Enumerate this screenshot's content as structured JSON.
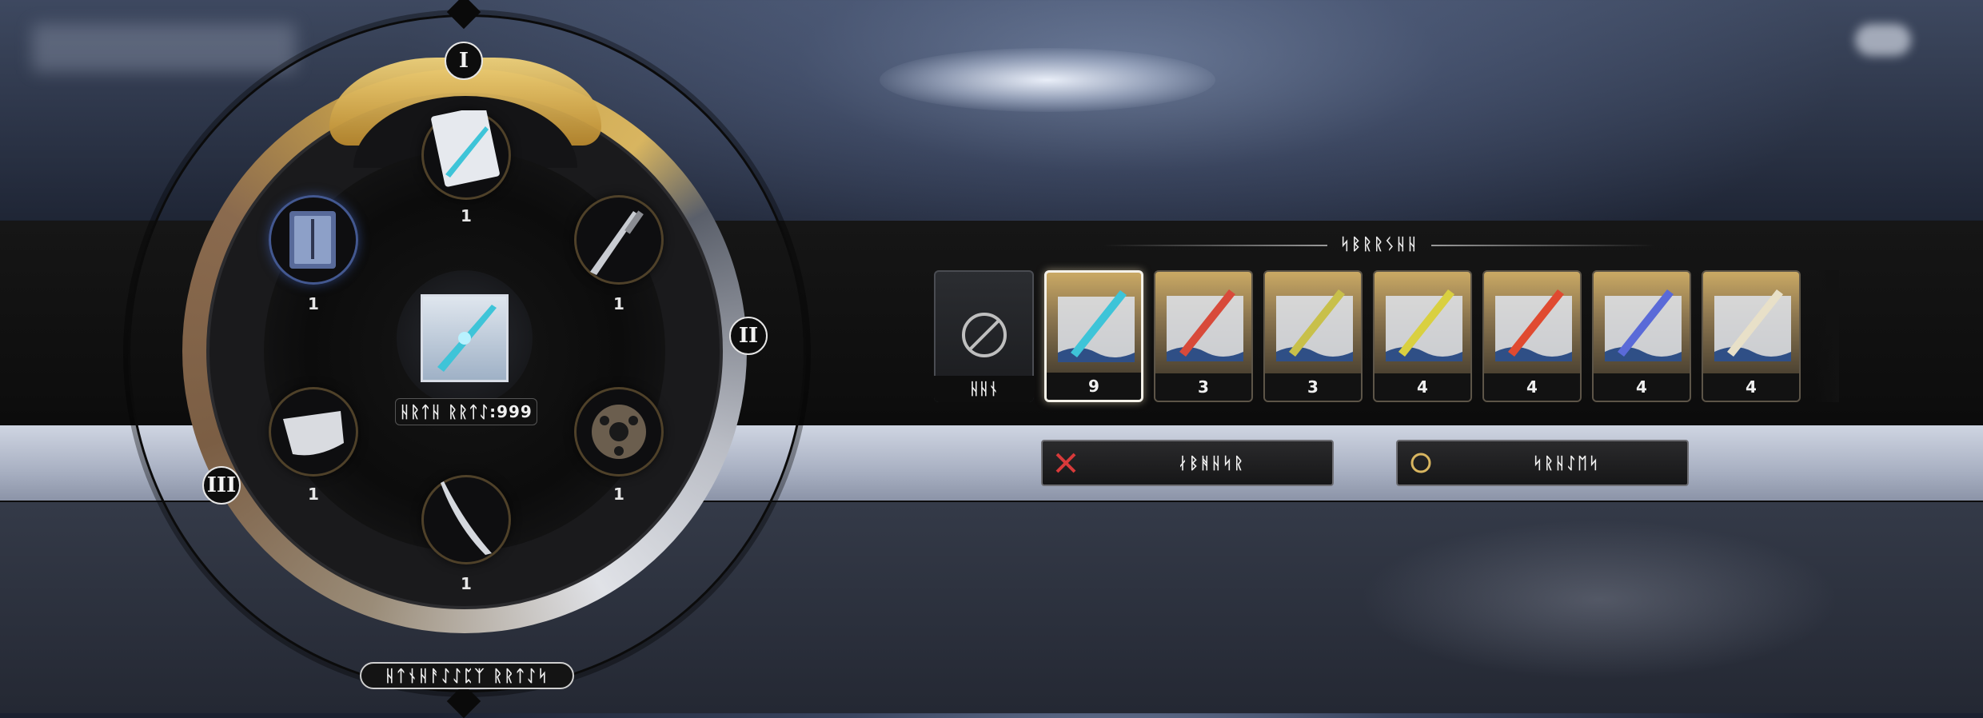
{
  "wheel": {
    "roman_top": "I",
    "roman_right": "II",
    "roman_left": "III",
    "center_label": "ᚺᚱᛏᚺ ᚱᚱᛏᛇ:999",
    "bottom_label": "ᚺᛏᚾᚺᚨᛇᛇᛈᛉ ᚱᚱᛏᛇᛋ",
    "slots": [
      {
        "name": "card",
        "count": "1"
      },
      {
        "name": "sword",
        "count": "1"
      },
      {
        "name": "orb",
        "count": "1"
      },
      {
        "name": "blade",
        "count": "1"
      },
      {
        "name": "cape",
        "count": "1"
      },
      {
        "name": "tome",
        "count": "1"
      }
    ]
  },
  "panel": {
    "title": "ᛋᛒᚱᚱᛊᚺᚺ",
    "none_label": "ᚺᚺᚾ",
    "items": [
      {
        "count": "9",
        "selected": true,
        "blade_color": "#3ec4d8"
      },
      {
        "count": "3",
        "selected": false,
        "blade_color": "#d84a3a"
      },
      {
        "count": "3",
        "selected": false,
        "blade_color": "#c8c04a"
      },
      {
        "count": "4",
        "selected": false,
        "blade_color": "#d9d040"
      },
      {
        "count": "4",
        "selected": false,
        "blade_color": "#e04a30"
      },
      {
        "count": "4",
        "selected": false,
        "blade_color": "#5a6ad8"
      },
      {
        "count": "4",
        "selected": false,
        "blade_color": "#e8e0c8"
      }
    ]
  },
  "buttons": {
    "cancel_label": "ᛅᛒᚻᚺᛋᚱ",
    "confirm_label": "ᛋᚱᚺᛇᛖᛋ"
  },
  "colors": {
    "gold": "#d8b560",
    "cancel_x": "#d83a3a",
    "confirm_circle": "#d8b560"
  }
}
